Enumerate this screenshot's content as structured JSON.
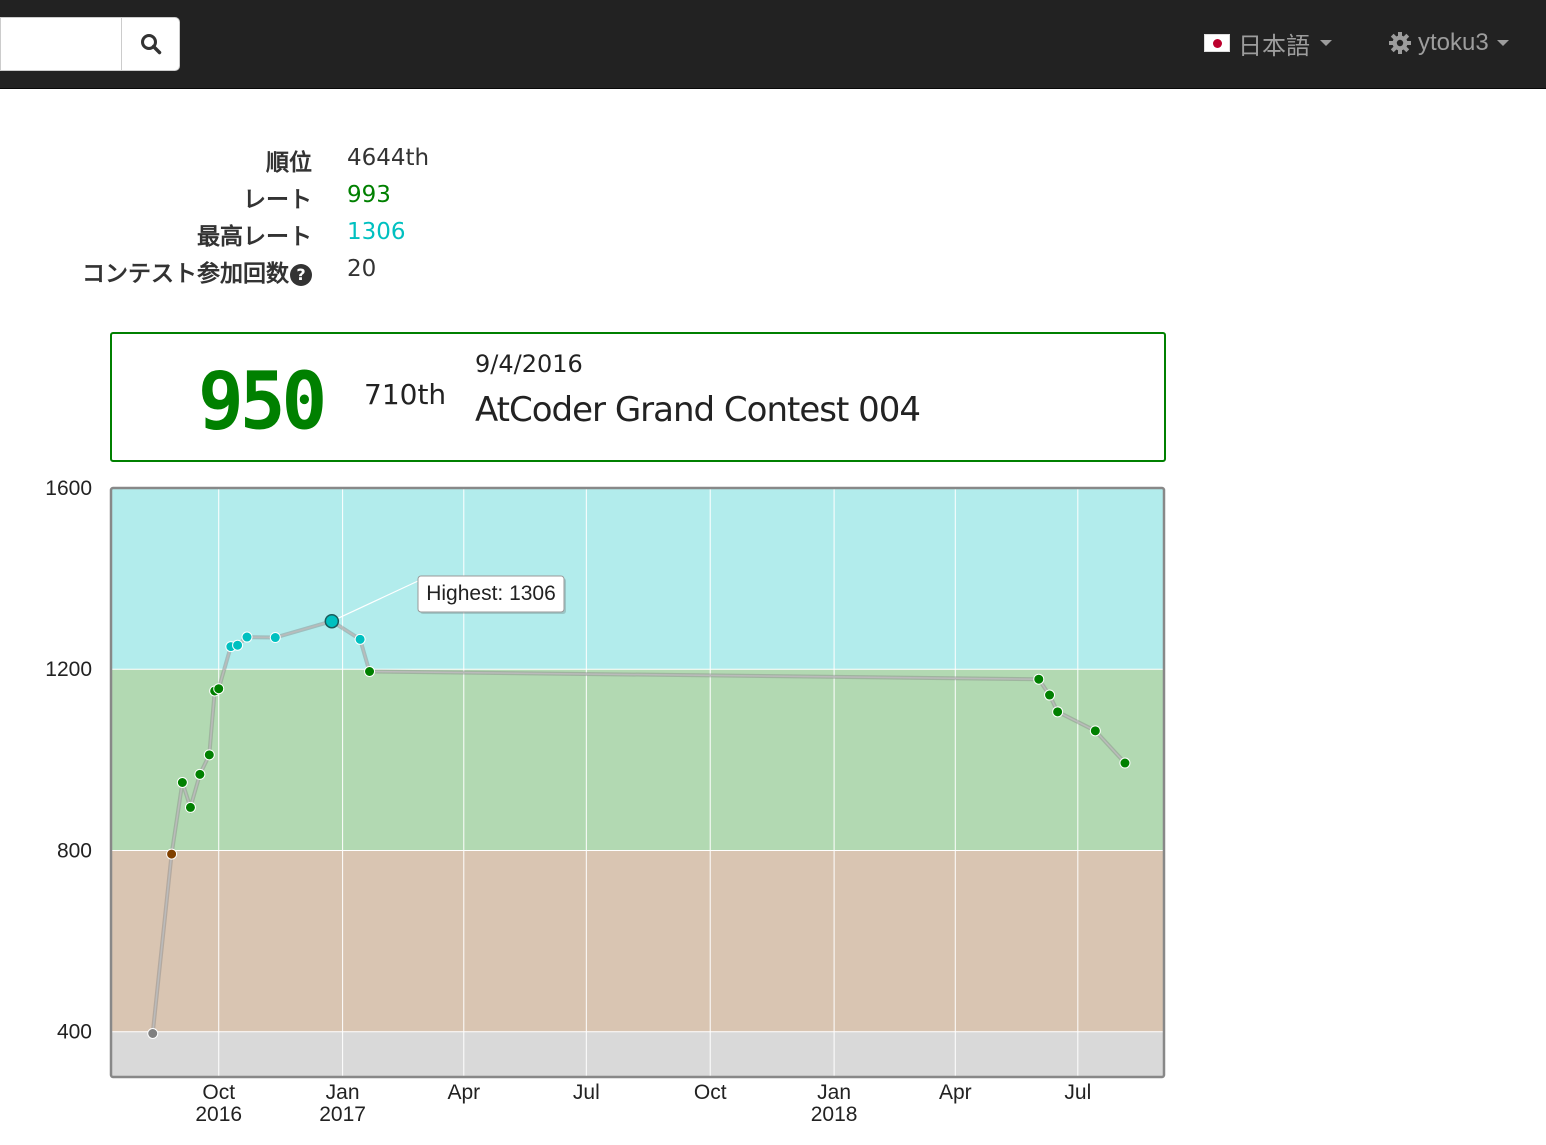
{
  "navbar": {
    "search_placeholder": "",
    "search_icon": "search-icon",
    "language_label": "日本語",
    "language_icon": "flag-jp-icon",
    "user_label": "ytoku3",
    "user_icon": "gear-icon"
  },
  "stats": {
    "rank_label": "順位",
    "rank_value": "4644th",
    "rating_label": "レート",
    "rating_value": "993",
    "rating_color": "#008000",
    "highest_label": "最高レート",
    "highest_value": "1306",
    "highest_color": "#00C0C0",
    "count_label": "コンテスト参加回数",
    "count_value": "20"
  },
  "panel": {
    "rating": "950",
    "rank": "710th",
    "date": "9/4/2016",
    "contest": "AtCoder Grand Contest 004"
  },
  "chart_data": {
    "type": "line",
    "ylim": [
      300,
      1600
    ],
    "yticks": [
      "1600",
      "1200",
      "800",
      "400"
    ],
    "ytick_values": [
      1600,
      1200,
      800,
      400
    ],
    "xlim": [
      "2016-07-13",
      "2018-09-03"
    ],
    "xticks": [
      {
        "date": "2016-10-01",
        "label1": "Oct",
        "label2": "2016"
      },
      {
        "date": "2017-01-01",
        "label1": "Jan",
        "label2": "2017"
      },
      {
        "date": "2017-04-01",
        "label1": "Apr",
        "label2": ""
      },
      {
        "date": "2017-07-01",
        "label1": "Jul",
        "label2": ""
      },
      {
        "date": "2017-10-01",
        "label1": "Oct",
        "label2": ""
      },
      {
        "date": "2018-01-01",
        "label1": "Jan",
        "label2": "2018"
      },
      {
        "date": "2018-04-01",
        "label1": "Apr",
        "label2": ""
      },
      {
        "date": "2018-07-01",
        "label1": "Jul",
        "label2": ""
      }
    ],
    "bands": [
      {
        "from": 0,
        "to": 400,
        "color": "#D9D9D9"
      },
      {
        "from": 400,
        "to": 800,
        "color": "#D9C5B2"
      },
      {
        "from": 800,
        "to": 1200,
        "color": "#B2D9B2"
      },
      {
        "from": 1200,
        "to": 1600,
        "color": "#B2ECEC"
      }
    ],
    "points": [
      {
        "x": "2016-08-13",
        "y": 396,
        "color": "#808080"
      },
      {
        "x": "2016-08-27",
        "y": 792,
        "color": "#804000"
      },
      {
        "x": "2016-09-04",
        "y": 950,
        "color": "#008000"
      },
      {
        "x": "2016-09-10",
        "y": 895,
        "color": "#008000"
      },
      {
        "x": "2016-09-17",
        "y": 968,
        "color": "#008000"
      },
      {
        "x": "2016-09-24",
        "y": 1011,
        "color": "#008000"
      },
      {
        "x": "2016-09-28",
        "y": 1152,
        "color": "#008000"
      },
      {
        "x": "2016-10-01",
        "y": 1157,
        "color": "#008000"
      },
      {
        "x": "2016-10-10",
        "y": 1250,
        "color": "#00C0C0"
      },
      {
        "x": "2016-10-15",
        "y": 1253,
        "color": "#00C0C0"
      },
      {
        "x": "2016-10-22",
        "y": 1271,
        "color": "#00C0C0"
      },
      {
        "x": "2016-11-12",
        "y": 1270,
        "color": "#00C0C0"
      },
      {
        "x": "2016-12-24",
        "y": 1306,
        "color": "#00C0C0",
        "highlight": true
      },
      {
        "x": "2017-01-14",
        "y": 1266,
        "color": "#00C0C0"
      },
      {
        "x": "2017-01-21",
        "y": 1195,
        "color": "#008000"
      },
      {
        "x": "2018-06-02",
        "y": 1178,
        "color": "#008000"
      },
      {
        "x": "2018-06-10",
        "y": 1143,
        "color": "#008000"
      },
      {
        "x": "2018-06-16",
        "y": 1106,
        "color": "#008000"
      },
      {
        "x": "2018-07-14",
        "y": 1064,
        "color": "#008000"
      },
      {
        "x": "2018-08-05",
        "y": 993,
        "color": "#008000"
      }
    ],
    "annotation": "Highest: 1306"
  }
}
